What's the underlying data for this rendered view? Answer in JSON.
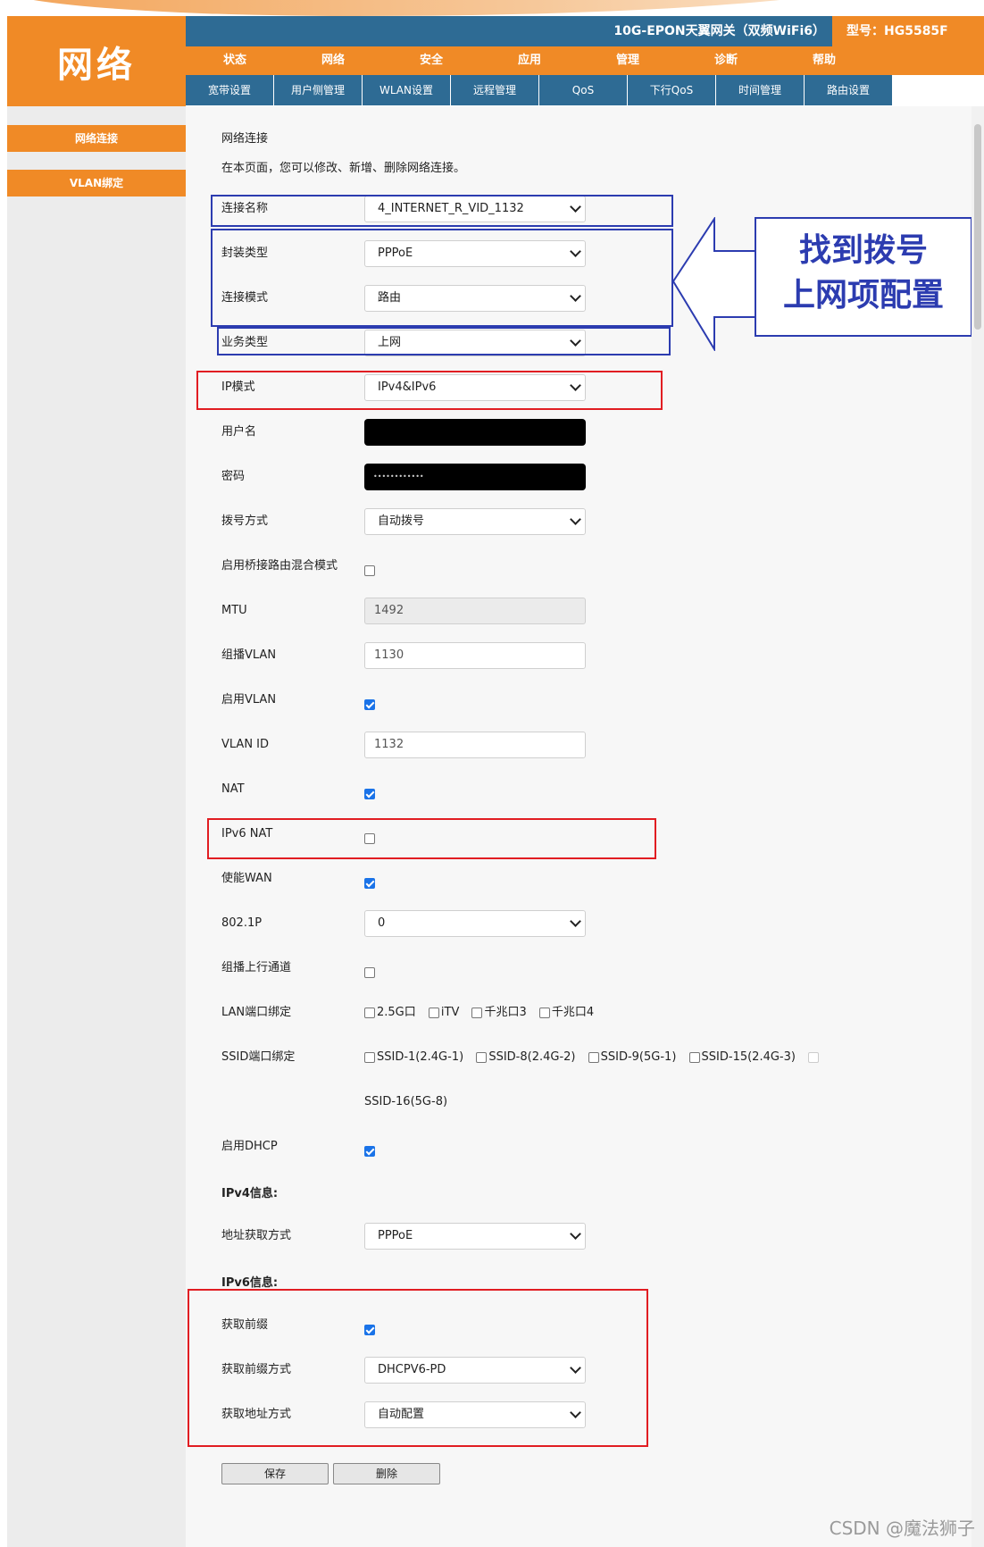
{
  "header": {
    "logo_text": "网络",
    "product_title": "10G-EPON天翼网关（双频WiFi6）",
    "model_text": "型号：HG5585F"
  },
  "main_nav": [
    "状态",
    "网络",
    "安全",
    "应用",
    "管理",
    "诊断",
    "帮助"
  ],
  "sub_nav": [
    "宽带设置",
    "用户侧管理",
    "WLAN设置",
    "远程管理",
    "QoS",
    "下行QoS",
    "时间管理",
    "路由设置"
  ],
  "sidebar": [
    "网络连接",
    "VLAN绑定"
  ],
  "page": {
    "title": "网络连接",
    "desc": "在本页面，您可以修改、新增、删除网络连接。"
  },
  "form": {
    "conn_name": {
      "label": "连接名称",
      "value": "4_INTERNET_R_VID_1132"
    },
    "encap": {
      "label": "封装类型",
      "value": "PPPoE"
    },
    "conn_mode": {
      "label": "连接模式",
      "value": "路由"
    },
    "service": {
      "label": "业务类型",
      "value": "上网"
    },
    "ip_mode": {
      "label": "IP模式",
      "value": "IPv4&IPv6"
    },
    "username": {
      "label": "用户名",
      "value": ""
    },
    "password": {
      "label": "密码",
      "value": "••••••••••••"
    },
    "dial": {
      "label": "拨号方式",
      "value": "自动拨号"
    },
    "bridge_mix": {
      "label": "启用桥接路由混合模式",
      "checked": false
    },
    "mtu": {
      "label": "MTU",
      "value": "1492"
    },
    "mcast_vlan": {
      "label": "组播VLAN",
      "value": "1130"
    },
    "enable_vlan": {
      "label": "启用VLAN",
      "checked": true
    },
    "vlan_id": {
      "label": "VLAN ID",
      "value": "1132"
    },
    "nat": {
      "label": "NAT",
      "checked": true
    },
    "ipv6_nat": {
      "label": "IPv6 NAT",
      "checked": false
    },
    "enable_wan": {
      "label": "使能WAN",
      "checked": true
    },
    "dot1p": {
      "label": "802.1P",
      "value": "0"
    },
    "mcast_up": {
      "label": "组播上行通道",
      "checked": false
    },
    "lan_bind": {
      "label": "LAN端口绑定",
      "options": [
        "2.5G口",
        "iTV",
        "千兆口3",
        "千兆口4"
      ]
    },
    "ssid_bind": {
      "label": "SSID端口绑定",
      "options": [
        "SSID-1(2.4G-1)",
        "SSID-8(2.4G-2)",
        "SSID-9(5G-1)",
        "SSID-15(2.4G-3)"
      ],
      "wrap_option": "SSID-16(5G-8)"
    },
    "enable_dhcp": {
      "label": "启用DHCP",
      "checked": true
    },
    "ipv4_header": "IPv4信息:",
    "addr_method": {
      "label": "地址获取方式",
      "value": "PPPoE"
    },
    "ipv6_header": "IPv6信息:",
    "get_prefix": {
      "label": "获取前缀",
      "checked": true
    },
    "prefix_method": {
      "label": "获取前缀方式",
      "value": "DHCPV6-PD"
    },
    "addr6_method": {
      "label": "获取地址方式",
      "value": "自动配置"
    }
  },
  "buttons": {
    "save": "保存",
    "delete": "删除"
  },
  "annotation": {
    "line1": "找到拨号",
    "line2": "上网项配置",
    "color": "#2c3cb0"
  },
  "watermark": "CSDN @魔法狮子",
  "colors": {
    "orange": "#f08a26",
    "blue": "#2e6b94",
    "red_box": "#e11d22"
  }
}
